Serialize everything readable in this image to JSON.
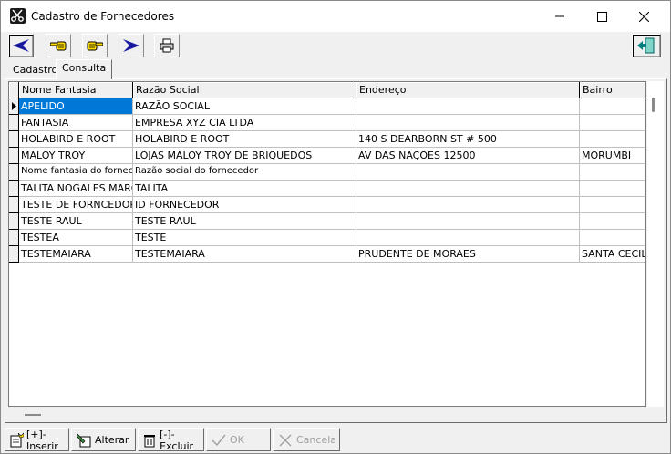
{
  "window": {
    "title": "Cadastro de Fornecedores",
    "controls": [
      "minimize-icon",
      "maximize-icon",
      "close-icon"
    ]
  },
  "toolbar": {
    "buttons": [
      {
        "icon": "arrow-left-icon"
      },
      {
        "icon": "hand-pointing-left-icon"
      },
      {
        "icon": "hand-pointing-right-icon"
      },
      {
        "icon": "arrow-right-icon"
      },
      {
        "icon": "printer-icon"
      },
      {
        "icon": "exit-door-icon"
      }
    ]
  },
  "tabs": [
    {
      "label": "Cadastro",
      "active": false
    },
    {
      "label": "Consulta",
      "active": true
    }
  ],
  "grid": {
    "columns": [
      "Nome Fantasia",
      "Razão Social",
      "Endereço",
      "Bairro"
    ],
    "rows": [
      [
        "APELIDO",
        "RAZÃO SOCIAL",
        "",
        ""
      ],
      [
        "FANTASIA",
        "EMPRESA XYZ CIA LTDA",
        "",
        ""
      ],
      [
        "HOLABIRD E ROOT",
        "HOLABIRD E ROOT",
        "140 S DEARBORN ST # 500",
        ""
      ],
      [
        "MALOY TROY",
        "LOJAS MALOY TROY DE BRIQUEDOS",
        "AV DAS NAÇÕES 12500",
        "MORUMBI"
      ],
      [
        "Nome fantasia do fornecedor",
        "Razão social do fornecedor",
        "",
        ""
      ],
      [
        "TALITA NOGALES MARQUES",
        "TALITA",
        "",
        ""
      ],
      [
        "TESTE DE FORNCEDOR",
        "ID FORNECEDOR",
        "",
        ""
      ],
      [
        "TESTE RAUL",
        "TESTE RAUL",
        "",
        ""
      ],
      [
        "TESTEA",
        "TESTE",
        "",
        ""
      ],
      [
        "TESTEMAIARA",
        "TESTEMAIARA",
        "PRUDENTE DE MORAES",
        "SANTA CECILIA"
      ]
    ]
  },
  "bottom_buttons": [
    {
      "label": "[+]-Inserir",
      "icon": "insert-record-icon",
      "enabled": true
    },
    {
      "label": "Alterar",
      "icon": "edit-record-icon",
      "enabled": true
    },
    {
      "label": "[-]-Excluir",
      "icon": "trash-icon",
      "enabled": true
    },
    {
      "label": "OK",
      "icon": "checkmark-icon",
      "enabled": false
    },
    {
      "label": "Cancela",
      "icon": "cross-icon",
      "enabled": false
    }
  ],
  "colors": {
    "selection": "#0078d7",
    "nav_arrow": "#1a1aa0",
    "face": "#f0f0f0"
  }
}
